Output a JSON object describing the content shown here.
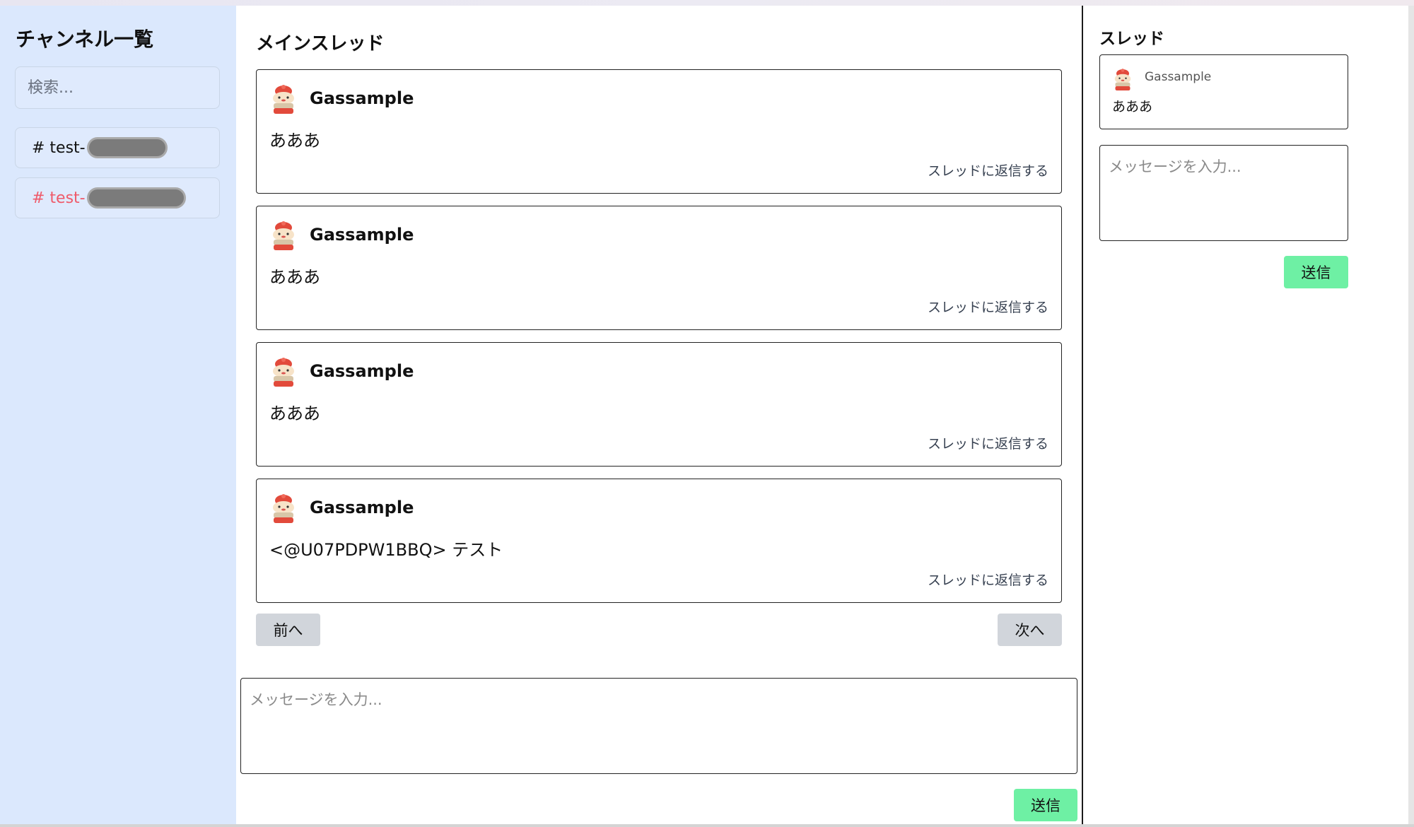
{
  "sidebar": {
    "title": "チャンネル一覧",
    "search_placeholder": "検索...",
    "channels": [
      {
        "label": "# test-",
        "active": false
      },
      {
        "label": "# test-",
        "active": true
      }
    ]
  },
  "main": {
    "title": "メインスレッド",
    "messages": [
      {
        "author": "Gassample",
        "text": "あああ",
        "reply_label": "スレッドに返信する"
      },
      {
        "author": "Gassample",
        "text": "あああ",
        "reply_label": "スレッドに返信する"
      },
      {
        "author": "Gassample",
        "text": "あああ",
        "reply_label": "スレッドに返信する"
      },
      {
        "author": "Gassample",
        "text": "<@U07PDPW1BBQ> テスト",
        "reply_label": "スレッドに返信する"
      }
    ],
    "prev_label": "前へ",
    "next_label": "次へ",
    "input_placeholder": "メッセージを入力...",
    "send_label": "送信"
  },
  "thread": {
    "title": "スレッド",
    "message": {
      "author": "Gassample",
      "text": "あああ"
    },
    "input_placeholder": "メッセージを入力...",
    "send_label": "送信"
  },
  "colors": {
    "sidebar_bg": "#dbe8fd",
    "active_channel": "#ef5a6a",
    "send_button": "#6ef0a4",
    "nav_button": "#d1d5db"
  },
  "icons": {
    "avatar": "cake-character-avatar-icon"
  }
}
